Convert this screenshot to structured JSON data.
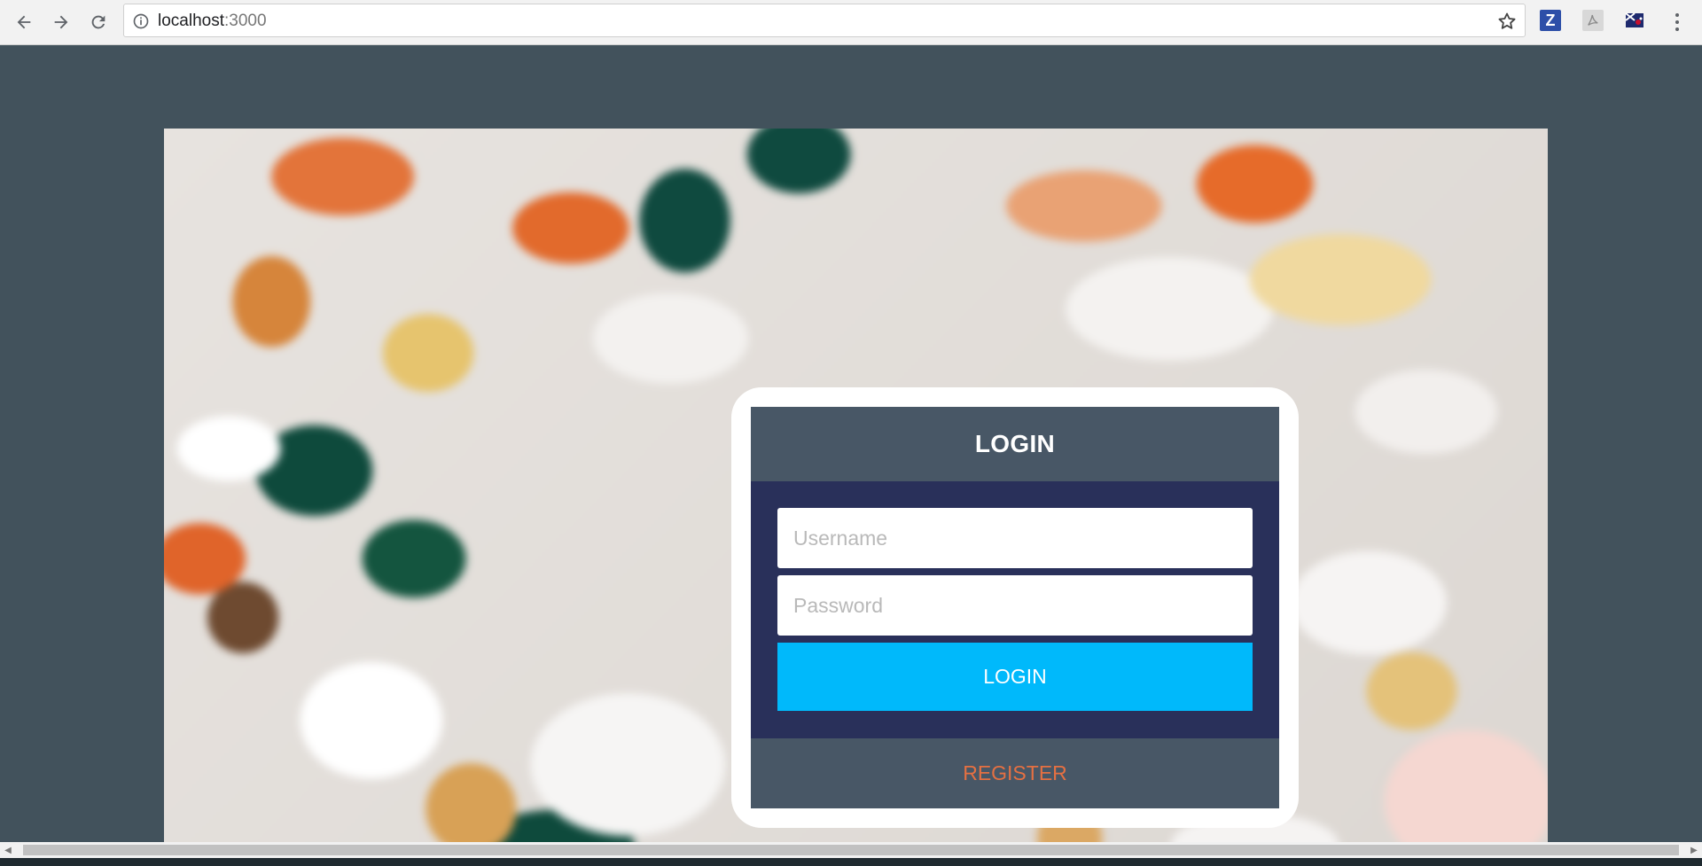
{
  "browser": {
    "url_host": "localhost",
    "url_port": ":3000",
    "icons": {
      "back": "arrow-left-icon",
      "forward": "arrow-right-icon",
      "reload": "reload-icon",
      "info": "info-icon",
      "bookmark": "star-icon",
      "menu": "kebab-menu-icon"
    },
    "extensions": {
      "zotero_letter": "Z"
    }
  },
  "login_card": {
    "title": "LOGIN",
    "username_placeholder": "Username",
    "password_placeholder": "Password",
    "login_button_label": "LOGIN",
    "register_label": "REGISTER"
  },
  "colors": {
    "page_background": "#42525c",
    "card_header": "#485766",
    "card_body": "#29305a",
    "login_button": "#00b9fb",
    "register_text": "#e57042"
  }
}
